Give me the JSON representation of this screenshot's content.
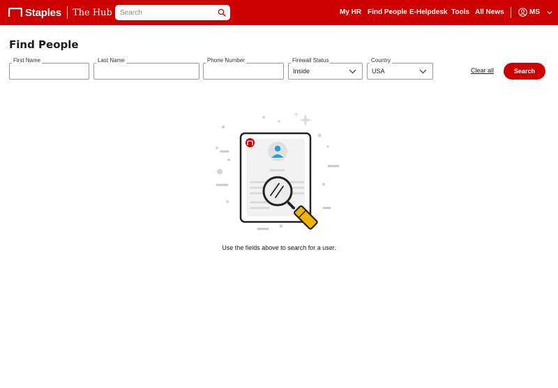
{
  "header": {
    "brand": "Staples",
    "sub_brand": "The Hub",
    "search_placeholder": "Search",
    "nav": [
      "My HR",
      "Find People",
      "E-Helpdesk",
      "Tools",
      "All News"
    ],
    "user_initials": "MS"
  },
  "page": {
    "title": "Find People"
  },
  "form": {
    "first_name_label": "First Name",
    "first_name_value": "",
    "last_name_label": "Last Name",
    "last_name_value": "",
    "phone_label": "Phone Number",
    "phone_value": "",
    "firewall_label": "Firewall Status",
    "firewall_value": "Inside",
    "country_label": "Country",
    "country_value": "USA",
    "clear_label": "Clear all",
    "search_label": "Search"
  },
  "empty_state": {
    "message": "Use the fields above to search for a user."
  },
  "colors": {
    "brand_red": "#cc0000",
    "magnifier_handle": "#f0b400",
    "avatar_blue": "#2a9fd6"
  }
}
